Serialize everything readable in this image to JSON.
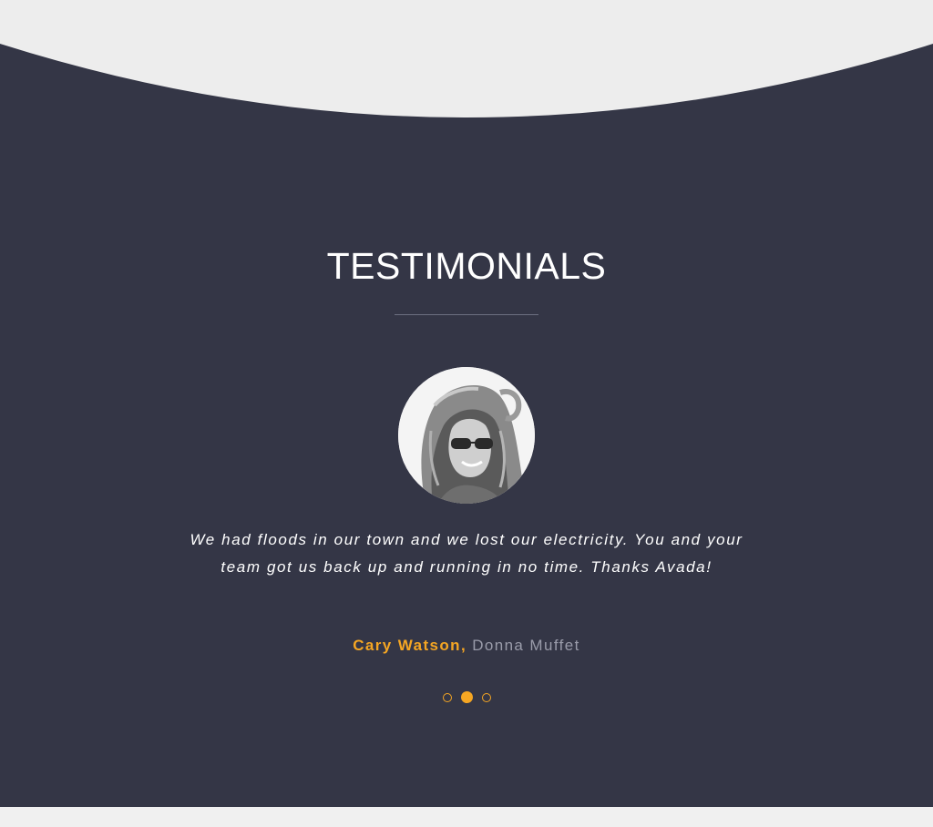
{
  "section": {
    "title": "TESTIMONIALS"
  },
  "testimonial": {
    "quote": "We had floods in our town and we lost our electricity. You and your team got us back up and running in no time. Thanks Avada!",
    "author_name": "Cary Watson",
    "author_separator": ", ",
    "author_company": "Donna Muffet",
    "avatar_icon": "woman-with-sunglasses-photo"
  },
  "pagination": {
    "count": 3,
    "active_index": 1
  },
  "colors": {
    "section_background": "#343646",
    "accent": "#f5a623",
    "muted_text": "#9a9caa",
    "band_background": "#ededed"
  }
}
